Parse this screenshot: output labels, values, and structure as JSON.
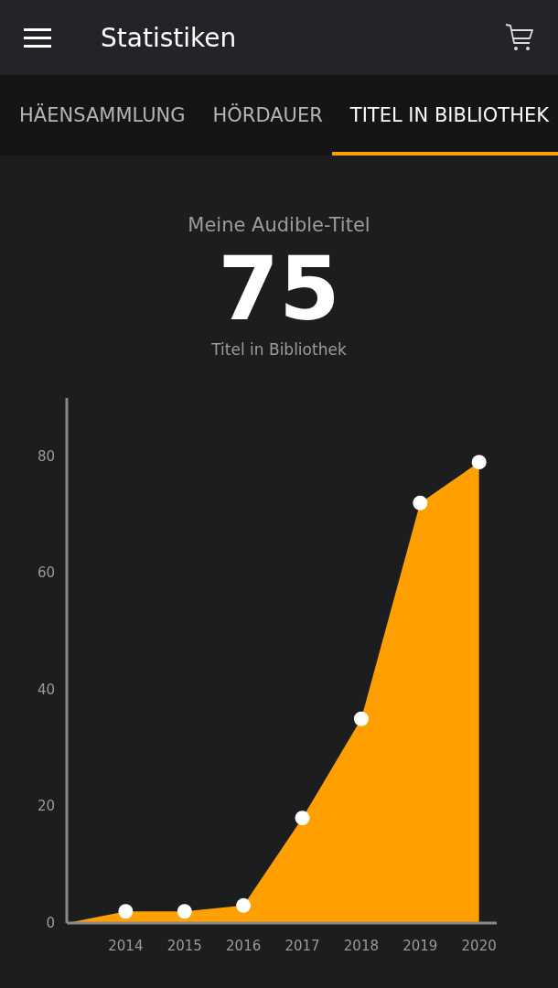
{
  "app_bar": {
    "title": "Statistiken"
  },
  "tabs": [
    {
      "label": "HÄENSAMMLUNG",
      "selected": false
    },
    {
      "label": "HÖRDAUER",
      "selected": false
    },
    {
      "label": "TITEL IN BIBLIOTHEK",
      "selected": true
    }
  ],
  "summary": {
    "heading": "Meine Audible-Titel",
    "count": "75",
    "caption": "Titel in Bibliothek"
  },
  "chart": {
    "chart_data": {
      "type": "area",
      "x": [
        2013,
        2014,
        2015,
        2016,
        2017,
        2018,
        2019,
        2020
      ],
      "values": [
        0,
        2,
        2,
        3,
        18,
        35,
        72,
        79
      ],
      "xticks": [
        2014,
        2015,
        2016,
        2017,
        2018,
        2019,
        2020
      ],
      "xlim": [
        2013,
        2020.3
      ],
      "ylim": [
        0,
        90
      ],
      "yticks": [
        0,
        20,
        40,
        60,
        80
      ]
    }
  }
}
